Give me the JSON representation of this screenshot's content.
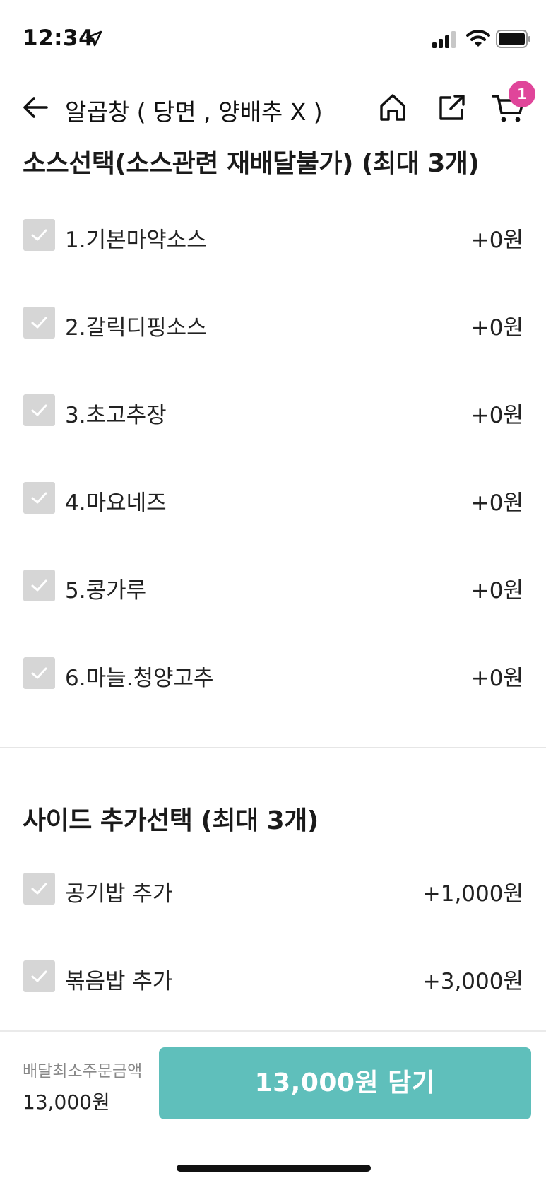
{
  "status_bar": {
    "time": "12:34"
  },
  "nav": {
    "title": "알곱창 ( 당면 , 양배추 X )",
    "cart_count": "1"
  },
  "sections": [
    {
      "title": "소스선택(소스관련 재배달불가) (최대 3개)",
      "options": [
        {
          "label": "1.기본마약소스",
          "price": "+0원",
          "checked": false
        },
        {
          "label": "2.갈릭디핑소스",
          "price": "+0원",
          "checked": false
        },
        {
          "label": "3.초고추장",
          "price": "+0원",
          "checked": false
        },
        {
          "label": "4.마요네즈",
          "price": "+0원",
          "checked": false
        },
        {
          "label": "5.콩가루",
          "price": "+0원",
          "checked": false
        },
        {
          "label": "6.마늘.청양고추",
          "price": "+0원",
          "checked": false
        }
      ]
    },
    {
      "title": "사이드 추가선택 (최대 3개)",
      "options": [
        {
          "label": "공기밥 추가",
          "price": "+1,000원",
          "checked": false
        },
        {
          "label": "볶음밥 추가",
          "price": "+3,000원",
          "checked": false
        }
      ]
    }
  ],
  "bottom": {
    "min_order_label": "배달최소주문금액",
    "min_order_value": "13,000원",
    "add_button_label": "13,000원 담기"
  },
  "colors": {
    "accent": "#5fbfbb",
    "badge": "#e0459a",
    "checkbox_unchecked": "#d6d6d6"
  }
}
